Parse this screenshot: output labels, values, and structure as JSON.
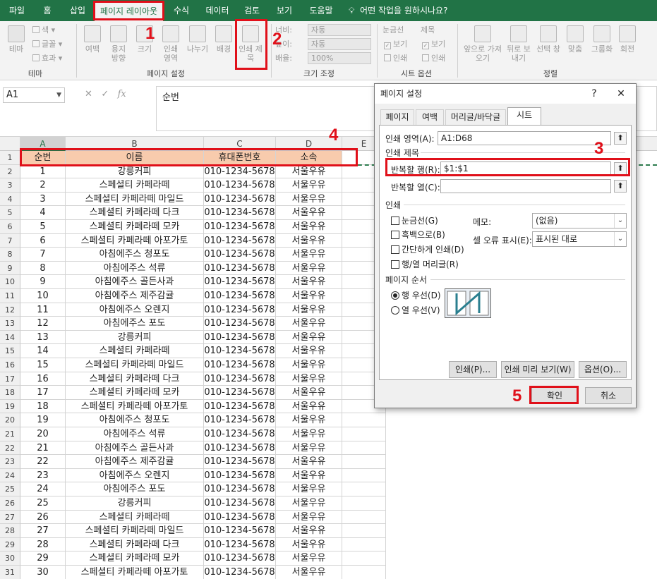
{
  "tabs": [
    "파일",
    "홈",
    "삽입",
    "페이지 레이아웃",
    "수식",
    "데이터",
    "검토",
    "보기",
    "도움말"
  ],
  "tell_me": "어떤 작업을 원하시나요?",
  "ribbon": {
    "theme": {
      "big": "테마",
      "colors": "색",
      "fonts": "글꼴",
      "effects": "효과",
      "group": "테마"
    },
    "page_setup": {
      "margins": "여백",
      "orientation": "용지 방향",
      "size": "크기",
      "print_area": "인쇄 영역",
      "breaks": "나누기",
      "background": "배경",
      "print_titles": "인쇄 제목",
      "group": "페이지 설정"
    },
    "scale": {
      "width": "너비:",
      "width_val": "자동",
      "height": "높이:",
      "height_val": "자동",
      "scale": "배율:",
      "scale_val": "100%",
      "group": "크기 조정"
    },
    "sheet_options": {
      "gridlines": "눈금선",
      "headings": "제목",
      "view": "보기",
      "print": "인쇄",
      "group": "시트 옵션"
    },
    "arrange": {
      "bring_forward": "앞으로 가져오기",
      "send_backward": "뒤로 보내기",
      "selection_pane": "선택 창",
      "align": "맞춤",
      "group_btn": "그룹화",
      "rotate": "회전",
      "group": "정렬"
    }
  },
  "formula_bar": {
    "name_box": "A1",
    "formula": "순번"
  },
  "columns": [
    "A",
    "B",
    "C",
    "D",
    "E"
  ],
  "header_row": {
    "num": "1",
    "cells": [
      "순번",
      "이름",
      "휴대폰번호",
      "소속"
    ]
  },
  "rows": [
    [
      "2",
      "1",
      "강릉커피",
      "010-1234-5678",
      "서울우유"
    ],
    [
      "3",
      "2",
      "스페셜티 카페라떼",
      "010-1234-5678",
      "서울우유"
    ],
    [
      "4",
      "3",
      "스페셜티 카페라떼 마일드",
      "010-1234-5678",
      "서울우유"
    ],
    [
      "5",
      "4",
      "스페셜티 카페라떼 다크",
      "010-1234-5678",
      "서울우유"
    ],
    [
      "6",
      "5",
      "스페셜티 카페라떼 모카",
      "010-1234-5678",
      "서울우유"
    ],
    [
      "7",
      "6",
      "스페셜티 카페라떼  아포가토",
      "010-1234-5678",
      "서울우유"
    ],
    [
      "8",
      "7",
      "아침에주스 청포도",
      "010-1234-5678",
      "서울우유"
    ],
    [
      "9",
      "8",
      "아침에주스 석류",
      "010-1234-5678",
      "서울우유"
    ],
    [
      "10",
      "9",
      "아침에주스 골든사과",
      "010-1234-5678",
      "서울우유"
    ],
    [
      "11",
      "10",
      "아침에주스 제주감귤",
      "010-1234-5678",
      "서울우유"
    ],
    [
      "12",
      "11",
      "아침에주스 오렌지",
      "010-1234-5678",
      "서울우유"
    ],
    [
      "13",
      "12",
      "아침에주스 포도",
      "010-1234-5678",
      "서울우유"
    ],
    [
      "14",
      "13",
      "강릉커피",
      "010-1234-5678",
      "서울우유"
    ],
    [
      "15",
      "14",
      "스페셜티 카페라떼",
      "010-1234-5678",
      "서울우유"
    ],
    [
      "16",
      "15",
      "스페셜티 카페라떼 마일드",
      "010-1234-5678",
      "서울우유"
    ],
    [
      "17",
      "16",
      "스페셜티 카페라떼 다크",
      "010-1234-5678",
      "서울우유"
    ],
    [
      "18",
      "17",
      "스페셜티 카페라떼 모카",
      "010-1234-5678",
      "서울우유"
    ],
    [
      "19",
      "18",
      "스페셜티 카페라떼  아포가토",
      "010-1234-5678",
      "서울우유"
    ],
    [
      "20",
      "19",
      "아침에주스 청포도",
      "010-1234-5678",
      "서울우유"
    ],
    [
      "21",
      "20",
      "아침에주스 석류",
      "010-1234-5678",
      "서울우유"
    ],
    [
      "22",
      "21",
      "아침에주스 골든사과",
      "010-1234-5678",
      "서울우유"
    ],
    [
      "23",
      "22",
      "아침에주스 제주감귤",
      "010-1234-5678",
      "서울우유"
    ],
    [
      "24",
      "23",
      "아침에주스 오렌지",
      "010-1234-5678",
      "서울우유"
    ],
    [
      "25",
      "24",
      "아침에주스 포도",
      "010-1234-5678",
      "서울우유"
    ],
    [
      "26",
      "25",
      "강릉커피",
      "010-1234-5678",
      "서울우유"
    ],
    [
      "27",
      "26",
      "스페셜티 카페라떼",
      "010-1234-5678",
      "서울우유"
    ],
    [
      "28",
      "27",
      "스페셜티 카페라떼 마일드",
      "010-1234-5678",
      "서울우유"
    ],
    [
      "29",
      "28",
      "스페셜티 카페라떼 다크",
      "010-1234-5678",
      "서울우유"
    ],
    [
      "30",
      "29",
      "스페셜티 카페라떼 모카",
      "010-1234-5678",
      "서울우유"
    ],
    [
      "31",
      "30",
      "스페셜티 카페라떼  아포가토",
      "010-1234-5678",
      "서울우유"
    ]
  ],
  "dialog": {
    "title": "페이지 설정",
    "help": "?",
    "close": "✕",
    "tabs": [
      "페이지",
      "여백",
      "머리글/바닥글",
      "시트"
    ],
    "print_area_label": "인쇄 영역(A):",
    "print_area_value": "A1:D68",
    "print_titles_label": "인쇄 제목",
    "rows_repeat_label": "반복할 행(R):",
    "rows_repeat_value": "$1:$1",
    "cols_repeat_label": "반복할 열(C):",
    "cols_repeat_value": "",
    "print_section": "인쇄",
    "gridlines": "눈금선(G)",
    "bw": "흑백으로(B)",
    "draft": "간단하게 인쇄(D)",
    "headings": "행/열 머리글(R)",
    "comments_label": "메모:",
    "comments_value": "(없음)",
    "errors_label": "셀 오류 표시(E):",
    "errors_value": "표시된 대로",
    "page_order": "페이지 순서",
    "down_over": "행 우선(D)",
    "over_down": "열 우선(V)",
    "btn_print": "인쇄(P)...",
    "btn_preview": "인쇄 미리 보기(W)",
    "btn_options": "옵션(O)...",
    "btn_ok": "확인",
    "btn_cancel": "취소"
  },
  "callouts": [
    "1",
    "2",
    "3",
    "4",
    "5"
  ],
  "colors": {
    "excel_green": "#217346",
    "header_fill": "#f8cbad",
    "callout_red": "#e0101a"
  }
}
